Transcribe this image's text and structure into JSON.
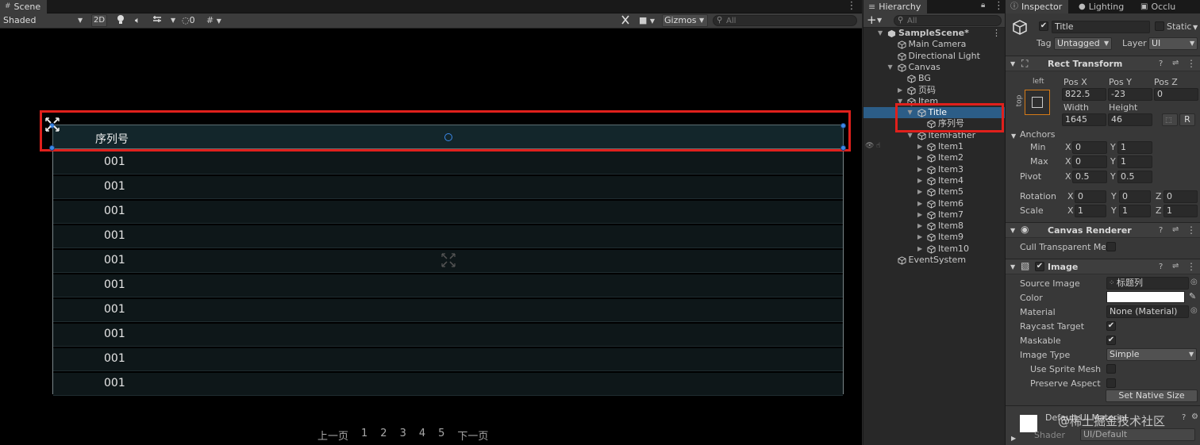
{
  "scene": {
    "tab_label": "Scene",
    "shading_mode": "Shaded",
    "mode_2d": "2D",
    "hidden_count": "0",
    "gizmos_label": "Gizmos",
    "search_placeholder": "All",
    "table_header": "序列号",
    "rows": [
      "001",
      "001",
      "001",
      "001",
      "001",
      "001",
      "001",
      "001",
      "001",
      "001"
    ],
    "pager": {
      "prev": "上一页",
      "pages": [
        "1",
        "2",
        "3",
        "4",
        "5"
      ],
      "next": "下一页"
    }
  },
  "hierarchy": {
    "tab_label": "Hierarchy",
    "search_placeholder": "All",
    "items": [
      {
        "label": "SampleScene*",
        "depth": 0,
        "arrow": "down",
        "bold": true,
        "icon": "unity-scene-icon"
      },
      {
        "label": "Main Camera",
        "depth": 1,
        "arrow": "",
        "icon": "gameobject-icon"
      },
      {
        "label": "Directional Light",
        "depth": 1,
        "arrow": "",
        "icon": "gameobject-icon"
      },
      {
        "label": "Canvas",
        "depth": 1,
        "arrow": "down",
        "icon": "gameobject-icon"
      },
      {
        "label": "BG",
        "depth": 2,
        "arrow": "",
        "icon": "gameobject-icon"
      },
      {
        "label": "页码",
        "depth": 2,
        "arrow": "right",
        "icon": "gameobject-icon"
      },
      {
        "label": "Item",
        "depth": 2,
        "arrow": "down",
        "icon": "gameobject-icon"
      },
      {
        "label": "Title",
        "depth": 3,
        "arrow": "down",
        "selected": true,
        "icon": "gameobject-icon"
      },
      {
        "label": "序列号",
        "depth": 4,
        "arrow": "",
        "icon": "gameobject-icon"
      },
      {
        "label": "ItemFather",
        "depth": 3,
        "arrow": "down",
        "icon": "gameobject-icon"
      },
      {
        "label": "Item1",
        "depth": 4,
        "arrow": "right",
        "icon": "gameobject-icon"
      },
      {
        "label": "Item2",
        "depth": 4,
        "arrow": "right",
        "icon": "gameobject-icon"
      },
      {
        "label": "Item3",
        "depth": 4,
        "arrow": "right",
        "icon": "gameobject-icon"
      },
      {
        "label": "Item4",
        "depth": 4,
        "arrow": "right",
        "icon": "gameobject-icon"
      },
      {
        "label": "Item5",
        "depth": 4,
        "arrow": "right",
        "icon": "gameobject-icon"
      },
      {
        "label": "Item6",
        "depth": 4,
        "arrow": "right",
        "icon": "gameobject-icon"
      },
      {
        "label": "Item7",
        "depth": 4,
        "arrow": "right",
        "icon": "gameobject-icon"
      },
      {
        "label": "Item8",
        "depth": 4,
        "arrow": "right",
        "icon": "gameobject-icon"
      },
      {
        "label": "Item9",
        "depth": 4,
        "arrow": "right",
        "icon": "gameobject-icon"
      },
      {
        "label": "Item10",
        "depth": 4,
        "arrow": "right",
        "icon": "gameobject-icon"
      },
      {
        "label": "EventSystem",
        "depth": 1,
        "arrow": "",
        "icon": "gameobject-icon"
      }
    ]
  },
  "inspector": {
    "tabs": [
      "Inspector",
      "Lighting",
      "Occlu"
    ],
    "object_name": "Title",
    "static_label": "Static",
    "tag_label": "Tag",
    "tag_value": "Untagged",
    "layer_label": "Layer",
    "layer_value": "UI",
    "rect_transform": {
      "title": "Rect Transform",
      "anchor_h": "left",
      "anchor_v": "top",
      "pos_x_label": "Pos X",
      "pos_y_label": "Pos Y",
      "pos_z_label": "Pos Z",
      "pos_x": "822.5",
      "pos_y": "-23",
      "pos_z": "0",
      "width_label": "Width",
      "height_label": "Height",
      "width": "1645",
      "height": "46",
      "r_button": "R",
      "anchors_label": "Anchors",
      "min_label": "Min",
      "max_label": "Max",
      "min_x": "0",
      "min_y": "1",
      "max_x": "0",
      "max_y": "1",
      "pivot_label": "Pivot",
      "pivot_x": "0.5",
      "pivot_y": "0.5",
      "rotation_label": "Rotation",
      "rot_x": "0",
      "rot_y": "0",
      "rot_z": "0",
      "scale_label": "Scale",
      "scale_x": "1",
      "scale_y": "1",
      "scale_z": "1",
      "x": "X",
      "y": "Y",
      "z": "Z"
    },
    "canvas_renderer": {
      "title": "Canvas Renderer",
      "cull_label": "Cull Transparent Mes"
    },
    "image": {
      "title": "Image",
      "source_image_label": "Source Image",
      "source_image_value": "标题列",
      "color_label": "Color",
      "material_label": "Material",
      "material_value": "None (Material)",
      "raycast_label": "Raycast Target",
      "maskable_label": "Maskable",
      "image_type_label": "Image Type",
      "image_type_value": "Simple",
      "use_sprite_mesh_label": "Use Sprite Mesh",
      "preserve_aspect_label": "Preserve Aspect",
      "native_size_button": "Set Native Size"
    },
    "material_footer": {
      "name": "Default UI Material",
      "shader_label": "Shader",
      "shader_value": "UI/Default"
    },
    "watermark": "@稀土掘金技术社区"
  },
  "colors": {
    "selection_red": "#e0201c",
    "handle_blue": "#3b88e8",
    "hierarchy_selected": "#2c5d87",
    "title_row_bg": "#13262b"
  }
}
